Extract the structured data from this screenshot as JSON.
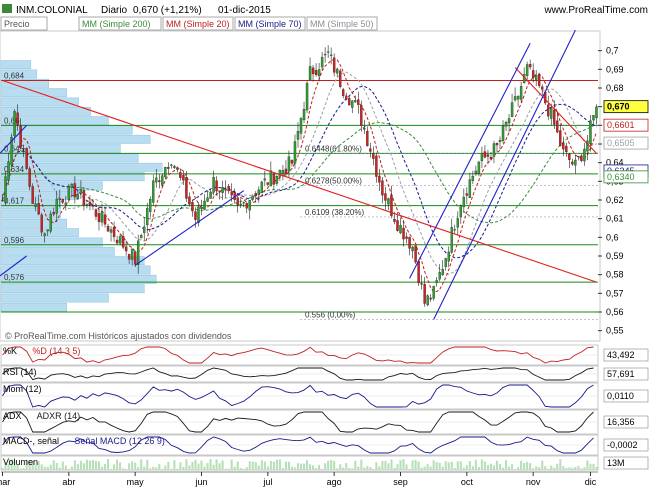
{
  "header": {
    "ticker": "INM.COLONIAL",
    "period": "Diario",
    "quote": "0,670 (+1,21%)",
    "date": "01-dic-2015",
    "site": "www.ProRealTime.com"
  },
  "legend": {
    "price": "Precio",
    "ma200": "MM (Simple 200)",
    "ma20": "MM (Simple 20)",
    "ma70": "MM (Simple 70)",
    "ma50": "MM (Simple 50)"
  },
  "colors": {
    "up": "#2f9f2f",
    "down": "#d02020",
    "ma200": "#3c8c3c",
    "ma20": "#c02020",
    "ma70": "#1a1a8a",
    "ma50": "#9aa0a8",
    "trend_red": "#e02020",
    "trend_blue": "#2020c8",
    "volume_profile": "#b8dcf0",
    "hline_green": "#1a8a1a",
    "hline_red": "#c02020"
  },
  "footer_note": "© ProRealTime.com  Históricos ajustados con dividendos",
  "chart_data": {
    "type": "candlestick",
    "y_axis": {
      "min": 0.545,
      "max": 0.71,
      "ticks": [
        "0,7",
        "0,69",
        "0,68",
        "0,67",
        "0,66",
        "0,65",
        "0,64",
        "0,63",
        "0,62",
        "0,61",
        "0,6",
        "0,59",
        "0,58",
        "0,57",
        "0,56",
        "0,55"
      ]
    },
    "x_axis": {
      "labels": [
        "mar",
        "abr",
        "may",
        "jun",
        "jul",
        "ago",
        "sep",
        "oct",
        "nov",
        "dic"
      ],
      "label_bars": [
        0,
        22,
        44,
        66,
        88,
        110,
        132,
        154,
        176,
        195
      ]
    },
    "bars": 198,
    "ohlc_anchors": [
      {
        "bar": 0,
        "close": 0.62
      },
      {
        "bar": 4,
        "close": 0.668
      },
      {
        "bar": 10,
        "close": 0.62
      },
      {
        "bar": 14,
        "close": 0.602
      },
      {
        "bar": 18,
        "close": 0.62
      },
      {
        "bar": 24,
        "close": 0.625
      },
      {
        "bar": 30,
        "close": 0.615
      },
      {
        "bar": 38,
        "close": 0.6
      },
      {
        "bar": 44,
        "close": 0.588
      },
      {
        "bar": 50,
        "close": 0.628
      },
      {
        "bar": 56,
        "close": 0.643
      },
      {
        "bar": 64,
        "close": 0.61
      },
      {
        "bar": 70,
        "close": 0.63
      },
      {
        "bar": 78,
        "close": 0.615
      },
      {
        "bar": 86,
        "close": 0.628
      },
      {
        "bar": 96,
        "close": 0.64
      },
      {
        "bar": 102,
        "close": 0.688
      },
      {
        "bar": 108,
        "close": 0.698
      },
      {
        "bar": 113,
        "close": 0.68
      },
      {
        "bar": 118,
        "close": 0.668
      },
      {
        "bar": 122,
        "close": 0.648
      },
      {
        "bar": 126,
        "close": 0.625
      },
      {
        "bar": 131,
        "close": 0.608
      },
      {
        "bar": 136,
        "close": 0.595
      },
      {
        "bar": 140,
        "close": 0.565
      },
      {
        "bar": 143,
        "close": 0.57
      },
      {
        "bar": 147,
        "close": 0.59
      },
      {
        "bar": 152,
        "close": 0.62
      },
      {
        "bar": 158,
        "close": 0.64
      },
      {
        "bar": 164,
        "close": 0.648
      },
      {
        "bar": 170,
        "close": 0.672
      },
      {
        "bar": 174,
        "close": 0.69
      },
      {
        "bar": 178,
        "close": 0.68
      },
      {
        "bar": 182,
        "close": 0.665
      },
      {
        "bar": 186,
        "close": 0.645
      },
      {
        "bar": 190,
        "close": 0.638
      },
      {
        "bar": 194,
        "close": 0.652
      },
      {
        "bar": 197,
        "close": 0.67
      }
    ],
    "fib_levels": [
      {
        "value": 0.6448,
        "label": "0.6448(61.80%)"
      },
      {
        "value": 0.6278,
        "label": "0.6278(50.00%)"
      },
      {
        "value": 0.6109,
        "label": "0.6109 (38.20%)"
      },
      {
        "value": 0.556,
        "label": "0.556 (0,00%)"
      }
    ],
    "horizontal_levels": [
      {
        "value": 0.684,
        "label": "0,684",
        "color": "red"
      },
      {
        "value": 0.66,
        "label": "0,66",
        "color": "green"
      },
      {
        "value": 0.645,
        "label": "0,645",
        "color": "green"
      },
      {
        "value": 0.634,
        "label": "0,634",
        "color": "green"
      },
      {
        "value": 0.617,
        "label": "0,617",
        "color": "green"
      },
      {
        "value": 0.596,
        "label": "0,596",
        "color": "green"
      },
      {
        "value": 0.576,
        "label": "0,576",
        "color": "green"
      },
      {
        "value": 0.56,
        "label": "",
        "color": "green"
      }
    ],
    "price_tags": [
      {
        "value": 0.67,
        "label": "0,670",
        "style": "current"
      },
      {
        "value": 0.6601,
        "label": "0,6601",
        "style": "ma20"
      },
      {
        "value": 0.6505,
        "label": "0,6505",
        "style": "ma50"
      },
      {
        "value": 0.6345,
        "label": "0,6345",
        "style": "ma70"
      },
      {
        "value": 0.634,
        "label": "0,6340",
        "style": "ma200"
      }
    ],
    "trendlines": [
      {
        "color": "red",
        "from": [
          0,
          0.684
        ],
        "to": [
          197,
          0.576
        ]
      },
      {
        "color": "red",
        "from": [
          170,
          0.691
        ],
        "to": [
          197,
          0.645
        ]
      },
      {
        "color": "blue",
        "from": [
          44,
          0.585
        ],
        "to": [
          80,
          0.625
        ]
      },
      {
        "color": "blue",
        "from": [
          -2,
          0.643
        ],
        "to": [
          8,
          0.66
        ]
      },
      {
        "color": "blue",
        "from": [
          -2,
          0.578
        ],
        "to": [
          8,
          0.59
        ]
      },
      {
        "color": "blue",
        "from": [
          135,
          0.578
        ],
        "to": [
          175,
          0.704
        ]
      },
      {
        "color": "blue",
        "from": [
          143,
          0.556
        ],
        "to": [
          190,
          0.711
        ]
      }
    ],
    "volume_profile": [
      {
        "price": 0.6925,
        "width": 0.05
      },
      {
        "price": 0.6875,
        "width": 0.06
      },
      {
        "price": 0.6825,
        "width": 0.08
      },
      {
        "price": 0.6775,
        "width": 0.11
      },
      {
        "price": 0.6725,
        "width": 0.13
      },
      {
        "price": 0.6675,
        "width": 0.15
      },
      {
        "price": 0.6625,
        "width": 0.18
      },
      {
        "price": 0.6575,
        "width": 0.22
      },
      {
        "price": 0.6525,
        "width": 0.25
      },
      {
        "price": 0.6475,
        "width": 0.2
      },
      {
        "price": 0.6425,
        "width": 0.23
      },
      {
        "price": 0.6375,
        "width": 0.27
      },
      {
        "price": 0.6325,
        "width": 0.24
      },
      {
        "price": 0.6275,
        "width": 0.17
      },
      {
        "price": 0.6225,
        "width": 0.13
      },
      {
        "price": 0.6175,
        "width": 0.1
      },
      {
        "price": 0.6125,
        "width": 0.1
      },
      {
        "price": 0.6075,
        "width": 0.11
      },
      {
        "price": 0.6025,
        "width": 0.13
      },
      {
        "price": 0.5975,
        "width": 0.17
      },
      {
        "price": 0.5925,
        "width": 0.19
      },
      {
        "price": 0.5875,
        "width": 0.24
      },
      {
        "price": 0.5825,
        "width": 0.25
      },
      {
        "price": 0.5775,
        "width": 0.26
      },
      {
        "price": 0.5725,
        "width": 0.24
      },
      {
        "price": 0.5675,
        "width": 0.18
      },
      {
        "price": 0.5625,
        "width": 0.11
      }
    ],
    "indicators": [
      {
        "title": "%K",
        "params": "%D (14 3 5)",
        "value": "43,492",
        "color": "#c02020"
      },
      {
        "title": "RSI (14)",
        "params": "",
        "value": "57,691",
        "color": "#1a1a1a"
      },
      {
        "title": "Mom (12)",
        "params": "",
        "value": "0,0110",
        "color": "#1a1a8a"
      },
      {
        "title": "ADX",
        "params": "ADXR (14)",
        "value": "16,356",
        "color": "#1a1a1a"
      },
      {
        "title": "MACD-, señal",
        "params": "Señal  MACD (12 26 9)",
        "value": "-0,0002",
        "color": "#1a1a8a"
      },
      {
        "title": "Volumen",
        "params": "",
        "value": "13M",
        "color": "#1a8a1a"
      }
    ]
  }
}
